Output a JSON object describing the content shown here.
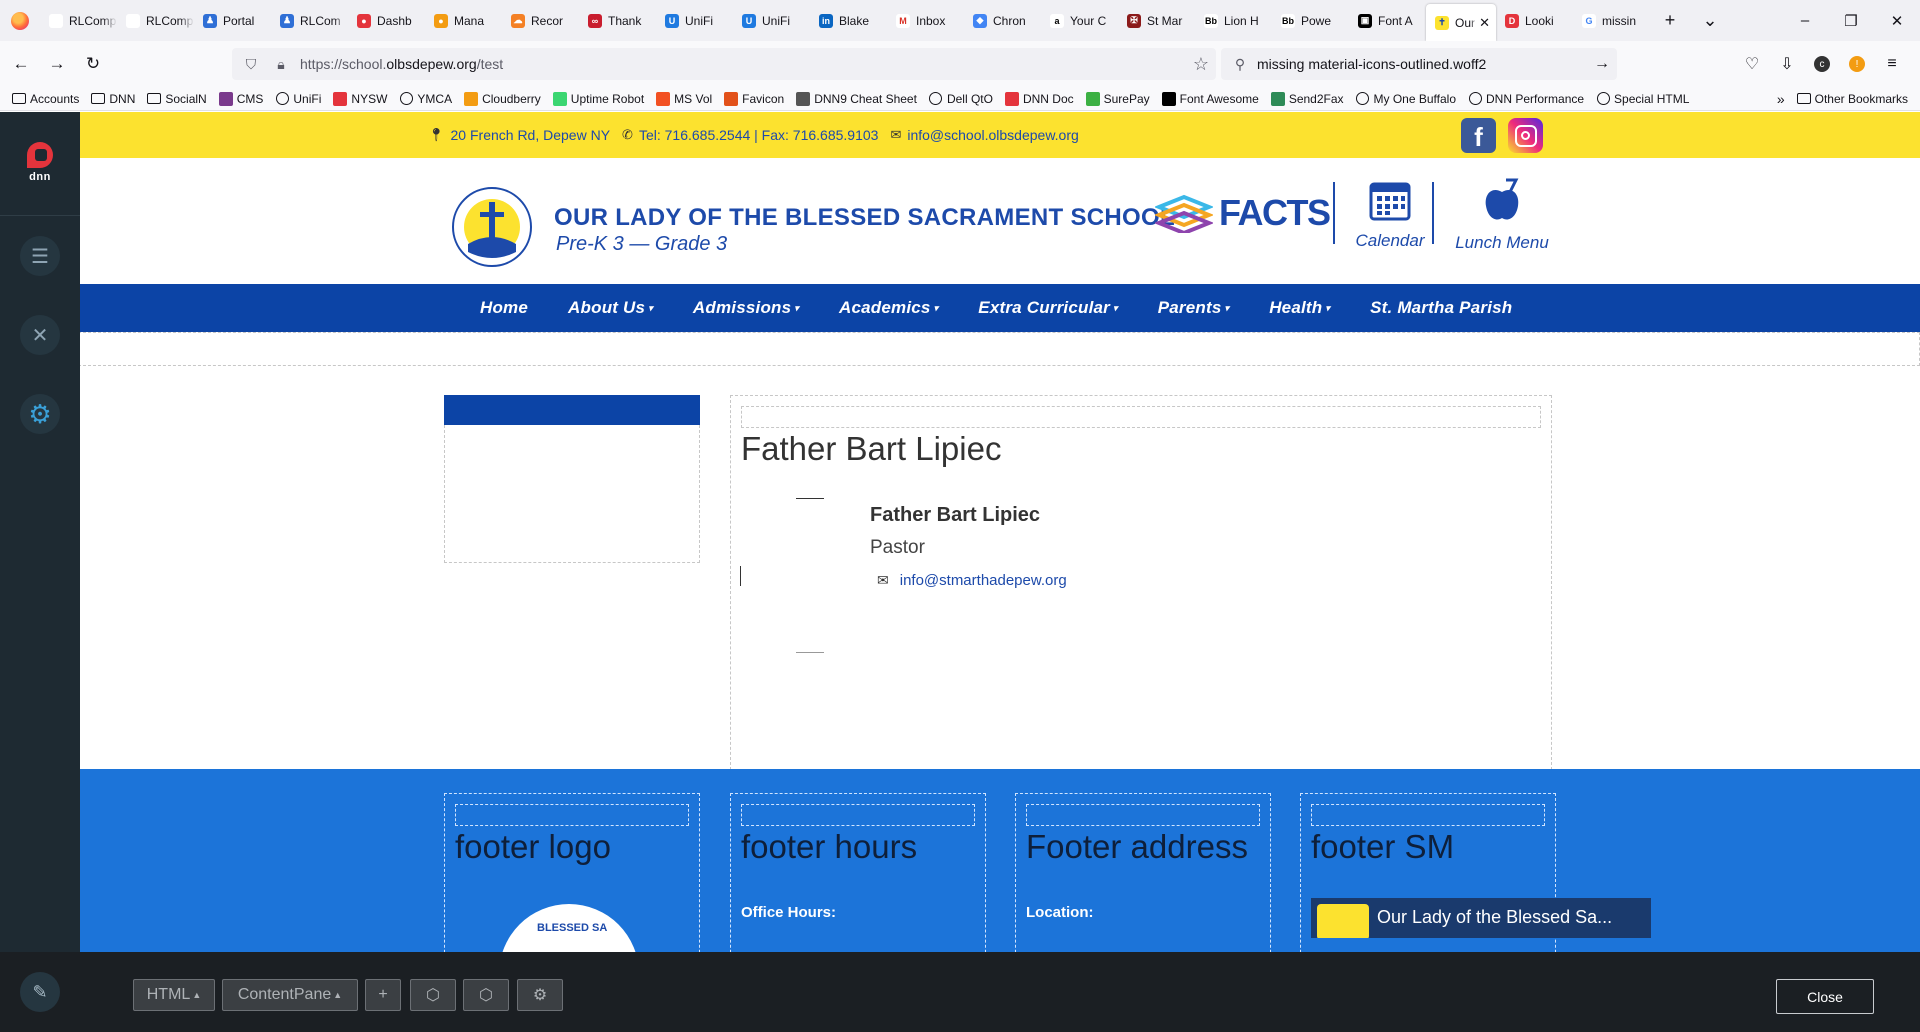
{
  "browser": {
    "tabs": [
      {
        "label": "RLCompu",
        "color": "#ffffff",
        "fg": "#000000",
        "glyph": ""
      },
      {
        "label": "RLCompu",
        "color": "#ffffff",
        "fg": "#000000",
        "glyph": ""
      },
      {
        "label": "Portal",
        "color": "#2f6fd6",
        "fg": "#ffffff",
        "glyph": "♟"
      },
      {
        "label": "RLCom",
        "color": "#2f6fd6",
        "fg": "#ffffff",
        "glyph": "♟"
      },
      {
        "label": "Dashb",
        "color": "#e4343c",
        "fg": "#ffffff",
        "glyph": "●"
      },
      {
        "label": "Mana",
        "color": "#f39c12",
        "fg": "#ffffff",
        "glyph": "●"
      },
      {
        "label": "Recor",
        "color": "#f48024",
        "fg": "#ffffff",
        "glyph": "☁"
      },
      {
        "label": "Thank",
        "color": "#c91d2e",
        "fg": "#ffffff",
        "glyph": "∞"
      },
      {
        "label": "UniFi",
        "color": "#1f7ae0",
        "fg": "#ffffff",
        "glyph": "U"
      },
      {
        "label": "UniFi",
        "color": "#1f7ae0",
        "fg": "#ffffff",
        "glyph": "U"
      },
      {
        "label": "Blake",
        "color": "#0a66c2",
        "fg": "#ffffff",
        "glyph": "in"
      },
      {
        "label": "Inbox",
        "color": "#ffffff",
        "fg": "#d93025",
        "glyph": "M"
      },
      {
        "label": "Chron",
        "color": "#4285f4",
        "fg": "#ffffff",
        "glyph": "◆"
      },
      {
        "label": "Your C",
        "color": "#ffffff",
        "fg": "#000000",
        "glyph": "a"
      },
      {
        "label": "St Mar",
        "color": "#8b1a1a",
        "fg": "#ffffff",
        "glyph": "✠"
      },
      {
        "label": "Lion H",
        "color": "#ffffff",
        "fg": "#000000",
        "glyph": "Bb"
      },
      {
        "label": "Powe",
        "color": "#ffffff",
        "fg": "#000000",
        "glyph": "Bb"
      },
      {
        "label": "Font A",
        "color": "#000000",
        "fg": "#ffffff",
        "glyph": "▣"
      },
      {
        "label": "Our",
        "color": "#fce22f",
        "fg": "#1d4aaa",
        "glyph": "✝",
        "active": true
      },
      {
        "label": "Looki",
        "color": "#e4343c",
        "fg": "#ffffff",
        "glyph": "D"
      },
      {
        "label": "missin",
        "color": "#ffffff",
        "fg": "#4285f4",
        "glyph": "G"
      }
    ],
    "new_tab_glyph": "+",
    "tab_list_glyph": "⌄",
    "window_controls": [
      "–",
      "❐",
      "✕"
    ],
    "nav": {
      "back": "←",
      "forward": "→",
      "reload": "↻"
    },
    "url": {
      "prefix": "https://school.",
      "domain": "olbsdepew.org",
      "path": "/test"
    },
    "search": {
      "value": "missing material-icons-outlined.woff2"
    },
    "bookmarks": [
      {
        "label": "Accounts",
        "kind": "folder"
      },
      {
        "label": "DNN",
        "kind": "folder"
      },
      {
        "label": "SocialN",
        "kind": "folder"
      },
      {
        "label": "CMS",
        "kind": "icon",
        "color": "#7a3a8c"
      },
      {
        "label": "UniFi",
        "kind": "globe"
      },
      {
        "label": "NYSW",
        "kind": "icon",
        "color": "#e4343c"
      },
      {
        "label": "YMCA",
        "kind": "globe"
      },
      {
        "label": "Cloudberry",
        "kind": "icon",
        "color": "#f39c12"
      },
      {
        "label": "Uptime Robot",
        "kind": "icon",
        "color": "#3bd671"
      },
      {
        "label": "MS Vol",
        "kind": "icon",
        "color": "#f25022"
      },
      {
        "label": "Favicon",
        "kind": "icon",
        "color": "#e2511a"
      },
      {
        "label": "DNN9 Cheat Sheet",
        "kind": "icon",
        "color": "#555555"
      },
      {
        "label": "Dell QtO",
        "kind": "globe"
      },
      {
        "label": "DNN Doc",
        "kind": "icon",
        "color": "#e4343c"
      },
      {
        "label": "SurePay",
        "kind": "icon",
        "color": "#3cb043"
      },
      {
        "label": "Font Awesome",
        "kind": "icon",
        "color": "#000000"
      },
      {
        "label": "Send2Fax",
        "kind": "icon",
        "color": "#2e8b57"
      },
      {
        "label": "My One Buffalo",
        "kind": "globe"
      },
      {
        "label": "DNN Performance",
        "kind": "globe"
      },
      {
        "label": "Special HTML",
        "kind": "globe"
      }
    ],
    "other_bookmarks": "Other Bookmarks"
  },
  "dnn": {
    "logo_text": "dnn",
    "edit_bar": {
      "module_label": "HTML",
      "pane_label": "ContentPane",
      "add_glyph": "+",
      "close_label": "Close"
    }
  },
  "site": {
    "topbar": {
      "address": "20 French Rd, Depew NY",
      "phone": "Tel: 716.685.2544 | Fax: 716.685.9103",
      "email": "info@school.olbsdepew.org"
    },
    "school_name": "OUR LADY OF THE BLESSED SACRAMENT SCHOOL",
    "grades": "Pre-K 3 — Grade 3",
    "facts_label": "FACTS",
    "calendar_label": "Calendar",
    "lunch_label": "Lunch Menu",
    "nav": [
      {
        "label": "Home",
        "caret": false
      },
      {
        "label": "About Us",
        "caret": true
      },
      {
        "label": "Admissions",
        "caret": true
      },
      {
        "label": "Academics",
        "caret": true
      },
      {
        "label": "Extra Curricular",
        "caret": true
      },
      {
        "label": "Parents",
        "caret": true
      },
      {
        "label": "Health",
        "caret": true
      },
      {
        "label": "St. Martha Parish",
        "caret": false
      }
    ],
    "content": {
      "title": "Father Bart Lipiec",
      "staff_name": "Father Bart Lipiec",
      "staff_role": "Pastor",
      "staff_email": "info@stmarthadepew.org"
    },
    "footer": {
      "logo_title": "footer logo",
      "hours_title": "footer hours",
      "hours_sub": "Office Hours:",
      "address_title": "Footer address",
      "address_sub": "Location:",
      "sm_title": "footer SM",
      "video_title": "Our Lady of the Blessed Sa...",
      "seal_text": "BLESSED SA"
    }
  }
}
